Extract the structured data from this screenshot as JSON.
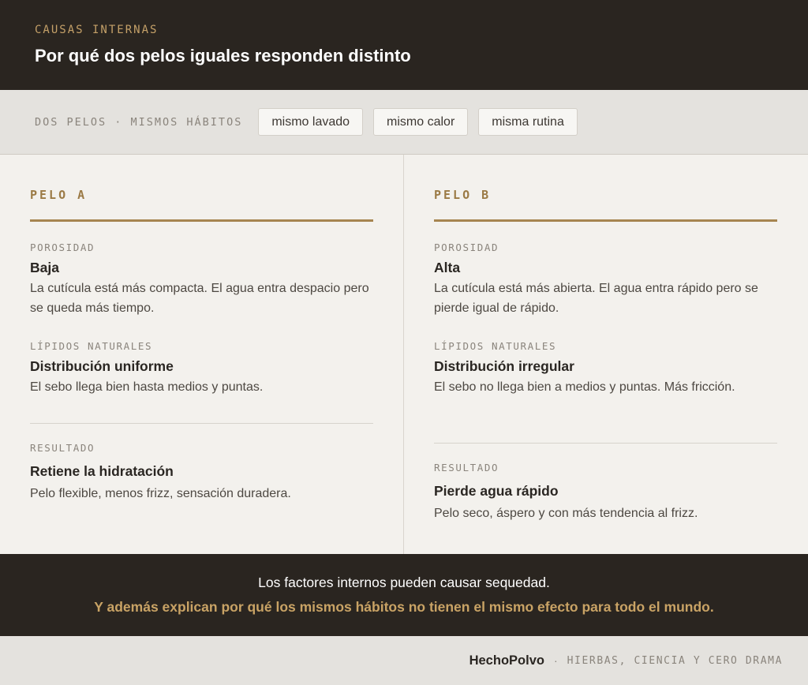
{
  "header": {
    "kicker": "CAUSAS INTERNAS",
    "title": "Por qué dos pelos iguales responden distinto"
  },
  "strip": {
    "label": "DOS PELOS · MISMOS HÁBITOS",
    "chips": [
      "mismo lavado",
      "mismo calor",
      "misma rutina"
    ]
  },
  "columns": [
    {
      "title": "PELO A",
      "porosity_label": "POROSIDAD",
      "porosity_value": "Baja",
      "porosity_desc": "La cutícula está más compacta. El agua entra despacio pero se queda más tiempo.",
      "lipids_label": "LÍPIDOS NATURALES",
      "lipids_value": "Distribución uniforme",
      "lipids_desc": "El sebo llega bien hasta medios y puntas.",
      "result_label": "RESULTADO",
      "result_value": "Retiene la hidratación",
      "result_desc": "Pelo flexible, menos frizz, sensación duradera."
    },
    {
      "title": "PELO B",
      "porosity_label": "POROSIDAD",
      "porosity_value": "Alta",
      "porosity_desc": "La cutícula está más abierta. El agua entra rápido pero se pierde igual de rápido.",
      "lipids_label": "LÍPIDOS NATURALES",
      "lipids_value": "Distribución irregular",
      "lipids_desc": "El sebo no llega bien a medios y puntas. Más fricción.",
      "result_label": "RESULTADO",
      "result_value": "Pierde agua rápido",
      "result_desc": "Pelo seco, áspero y con más tendencia al frizz."
    }
  ],
  "conclusion": {
    "line1": "Los factores internos pueden causar sequedad.",
    "line2": "Y además explican por qué los mismos hábitos no tienen el mismo efecto para todo el mundo."
  },
  "footer": {
    "brand": "HechoPolvo",
    "separator": "·",
    "tagline": "HIERBAS, CIENCIA Y CERO DRAMA"
  }
}
